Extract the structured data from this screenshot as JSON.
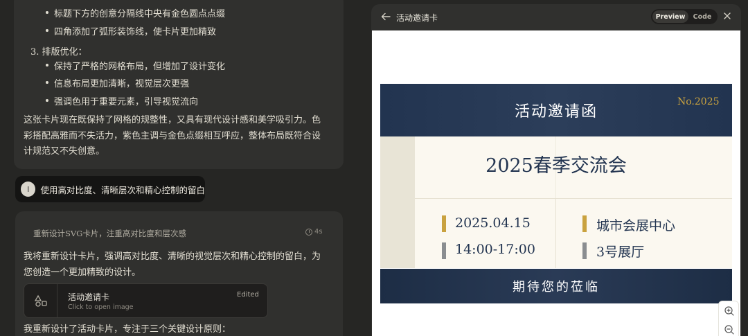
{
  "chat": {
    "previous_reply": {
      "bullets_top": [
        "标题下方的创意分隔线中央有金色圆点点缀",
        "四角添加了弧形装饰线，使卡片更加精致"
      ],
      "section_3_heading": "3. 排版优化：",
      "section_3_bullets": [
        "保持了严格的网格布局，但增加了设计变化",
        "信息布局更加清晰，视觉层次更强",
        "强调色用于重要元素，引导视觉流向"
      ],
      "summary": "这张卡片现在既保持了网格的规整性，又具有现代设计感和美学吸引力。色彩搭配高雅而不失活力，紫色主调与金色点缀相互呼应，整体布局既符合设计规范又不失创意。"
    },
    "user_message": {
      "avatar_initial": "I",
      "text": "使用高对比度、清晰层次和精心控制的留白"
    },
    "response": {
      "thinking_label": "重新设计SVG卡片，注重高对比度和层次感",
      "thinking_time": "4s",
      "intro": "我将重新设计卡片，强调高对比度、清晰的视觉层次和精心控制的留白，为您创造一个更加精致的设计。",
      "artifact": {
        "title": "活动邀请卡",
        "subtitle": "Click to open image",
        "status": "Edited",
        "icon": "shapes-icon"
      },
      "outro": "我重新设计了活动卡片，专注于三个关键设计原则："
    }
  },
  "panel": {
    "title": "活动邀请卡",
    "tabs": {
      "preview": "Preview",
      "code": "Code"
    },
    "active_tab": "Preview",
    "icons": {
      "back": "arrow-left-icon",
      "close": "close-icon",
      "zoom_in": "zoom-in-icon",
      "zoom_out": "zoom-out-icon"
    }
  },
  "invitation": {
    "header": "活动邀请函",
    "number": "No.2025",
    "event_name": "2025春季交流会",
    "date": "2025.04.15",
    "time": "14:00-17:00",
    "venue": "城市会展中心",
    "hall": "3号展厅",
    "footer": "期待您的莅临",
    "colors": {
      "navy": "#223450",
      "gold": "#c9a23f",
      "gray": "#8a8d90",
      "cream": "#fbf8f0"
    }
  }
}
